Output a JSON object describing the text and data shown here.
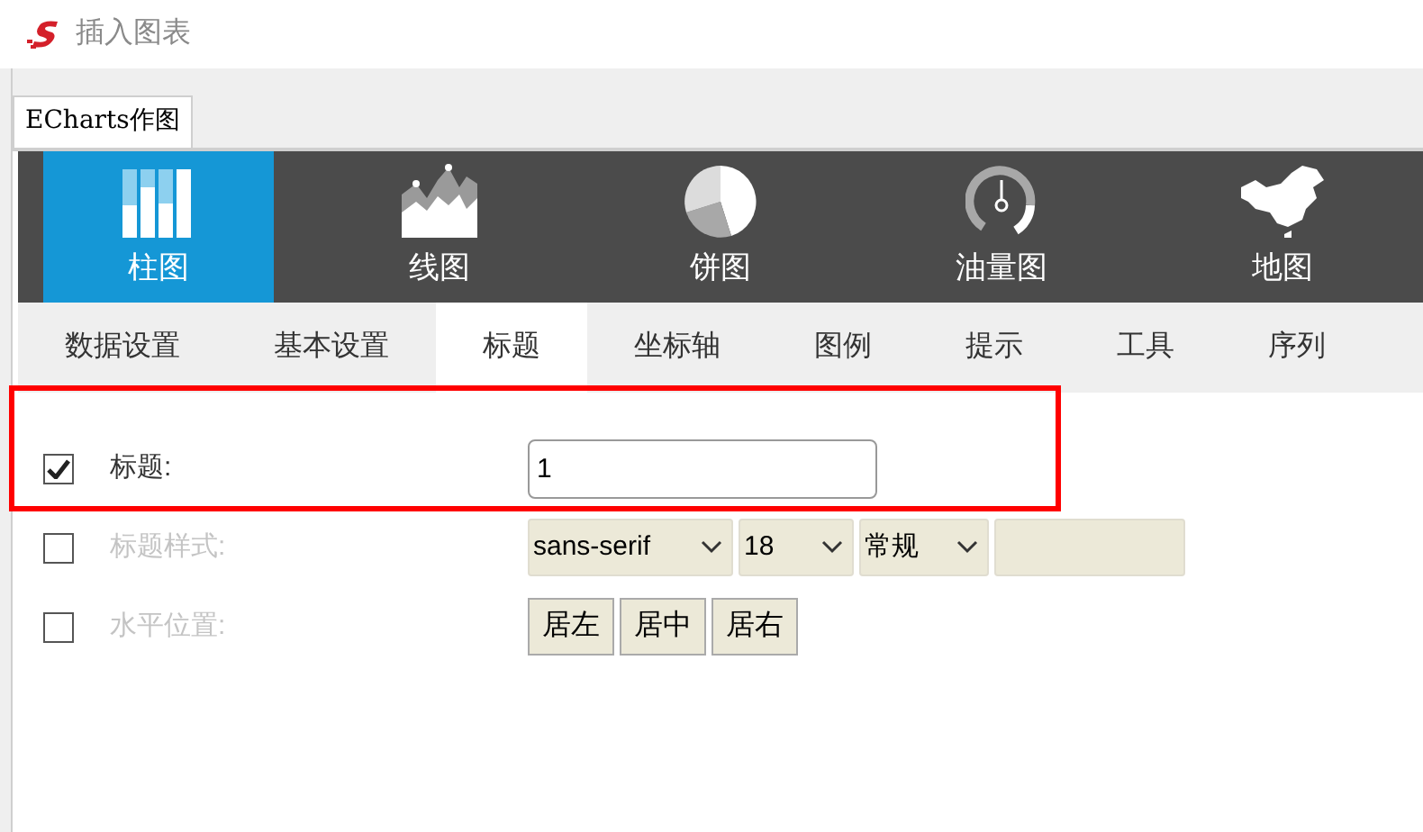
{
  "window": {
    "title": "插入图表"
  },
  "tab": {
    "label": "ECharts作图",
    "selected": true
  },
  "chart_types": [
    {
      "label": "柱图",
      "selected": true
    },
    {
      "label": "线图",
      "selected": false
    },
    {
      "label": "饼图",
      "selected": false
    },
    {
      "label": "油量图",
      "selected": false
    },
    {
      "label": "地图",
      "selected": false
    }
  ],
  "settings_tabs": [
    {
      "label": "数据设置",
      "selected": false
    },
    {
      "label": "基本设置",
      "selected": false
    },
    {
      "label": "标题",
      "selected": true
    },
    {
      "label": "坐标轴",
      "selected": false
    },
    {
      "label": "图例",
      "selected": false
    },
    {
      "label": "提示",
      "selected": false
    },
    {
      "label": "工具",
      "selected": false
    },
    {
      "label": "序列",
      "selected": false
    }
  ],
  "rows": [
    {
      "kind": "text",
      "label": "标题:",
      "checked": true,
      "highlighted": true,
      "value": "1"
    },
    {
      "kind": "font",
      "label": "标题样式:",
      "checked": false,
      "highlighted": false,
      "selects": [
        "sans-serif",
        "18",
        "常规"
      ]
    },
    {
      "kind": "buttons",
      "label": "水平位置:",
      "checked": false,
      "highlighted": false,
      "buttons": [
        "居左",
        "居中",
        "居右"
      ]
    }
  ]
}
